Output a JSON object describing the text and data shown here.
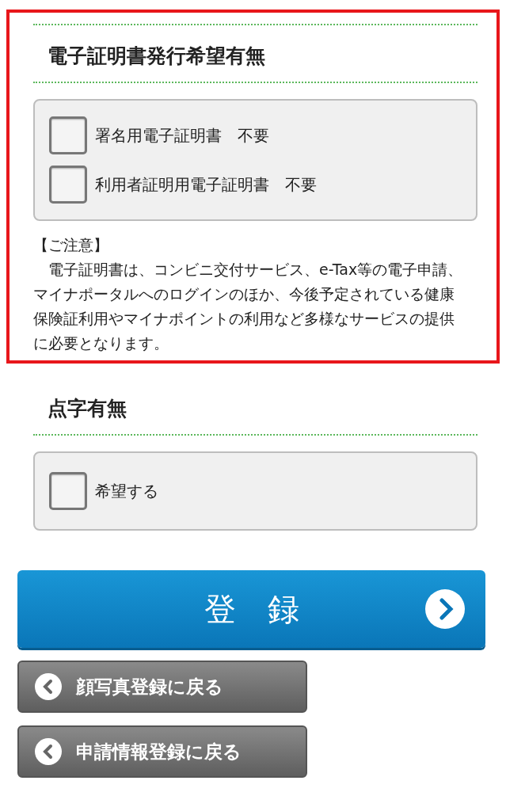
{
  "sections": [
    {
      "title": "電子証明書発行希望有無",
      "highlighted": true,
      "options": [
        {
          "label": "署名用電子証明書　不要",
          "checked": false
        },
        {
          "label": "利用者証明用電子証明書　不要",
          "checked": false
        }
      ],
      "note": {
        "title": "【ご注意】",
        "text": "　電子証明書は、コンビニ交付サービス、e-Tax等の電子申請、マイナポータルへのログインのほか、今後予定されている健康保険証利用やマイナポイントの利用など多様なサービスの提供に必要となります。"
      }
    },
    {
      "title": "点字有無",
      "highlighted": false,
      "options": [
        {
          "label": "希望する",
          "checked": false
        }
      ]
    }
  ],
  "buttons": [
    {
      "kind": "primary",
      "label": "登　録"
    },
    {
      "kind": "back",
      "label": "顔写真登録に戻る"
    },
    {
      "kind": "back",
      "label": "申請情報登録に戻る"
    }
  ]
}
